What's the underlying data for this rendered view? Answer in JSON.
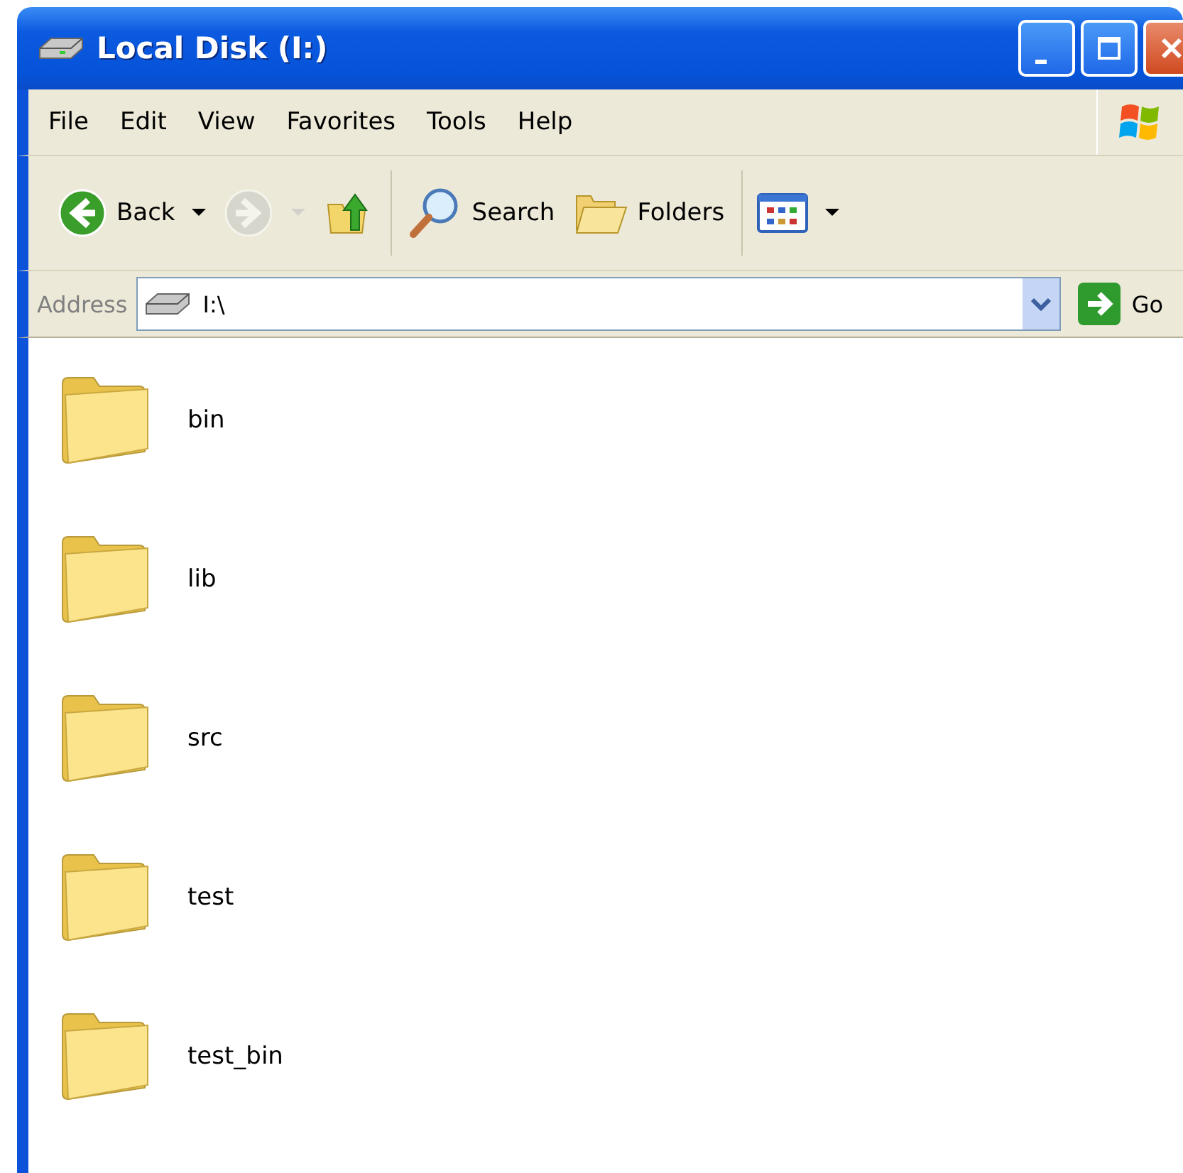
{
  "window": {
    "title": "Local Disk (I:)"
  },
  "menu": [
    "File",
    "Edit",
    "View",
    "Favorites",
    "Tools",
    "Help"
  ],
  "toolbar": [
    {
      "kind": "back",
      "label": "Back",
      "disabled": false
    },
    {
      "kind": "forward",
      "disabled": true
    },
    {
      "kind": "up",
      "disabled": false
    },
    {
      "kind": "search",
      "label": "Search",
      "disabled": false
    },
    {
      "kind": "folders",
      "label": "Folders",
      "disabled": false
    },
    {
      "kind": "views",
      "disabled": false
    }
  ],
  "address": {
    "label": "Address",
    "value": "I:\\",
    "go": "Go"
  },
  "items": [
    {
      "name": "bin"
    },
    {
      "name": "lib"
    },
    {
      "name": "src"
    },
    {
      "name": "test"
    },
    {
      "name": "test_bin"
    }
  ]
}
